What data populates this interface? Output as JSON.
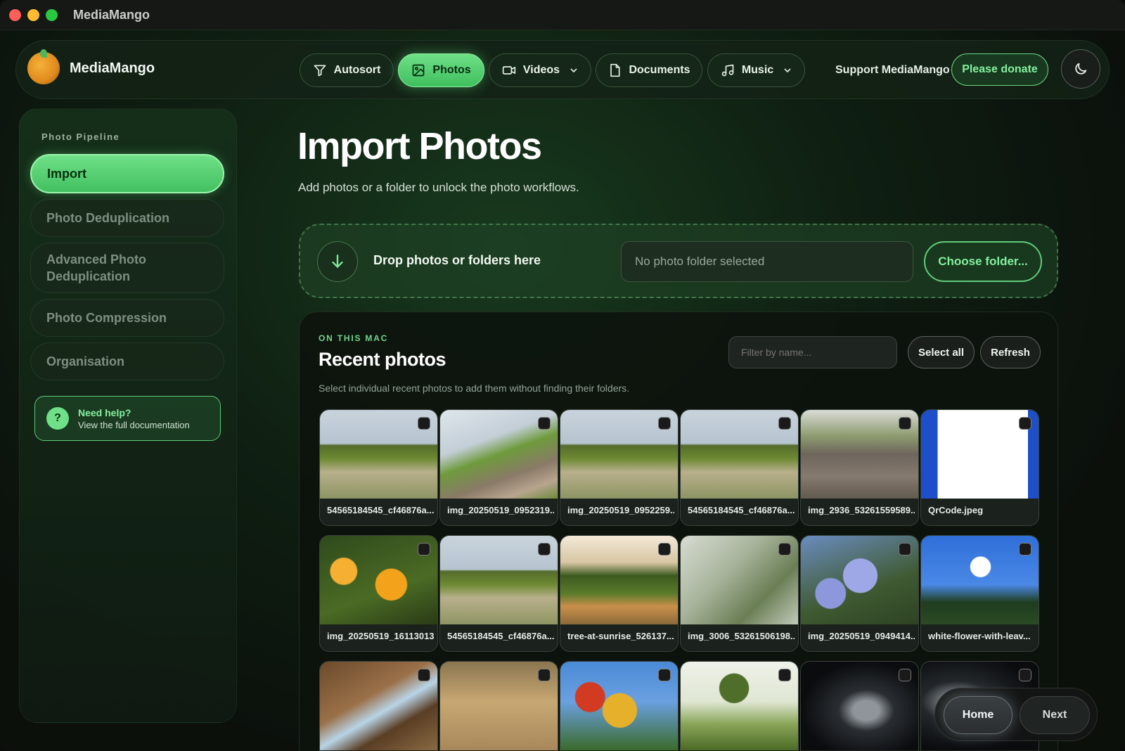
{
  "window": {
    "title": "MediaMango"
  },
  "nav": {
    "brand": "MediaMango",
    "tabs": [
      {
        "label": "Autosort",
        "icon": "filter-icon"
      },
      {
        "label": "Photos",
        "icon": "image-icon",
        "active": true
      },
      {
        "label": "Videos",
        "icon": "video-icon",
        "dropdown": true
      },
      {
        "label": "Documents",
        "icon": "document-icon"
      },
      {
        "label": "Music",
        "icon": "music-note-icon",
        "dropdown": true
      }
    ],
    "support_label": "Support MediaMango",
    "donate_label": "Please donate",
    "theme_icon": "moon-icon"
  },
  "sidebar": {
    "section_label": "Photo Pipeline",
    "items": [
      {
        "label": "Import",
        "active": true
      },
      {
        "label": "Photo Deduplication"
      },
      {
        "label": "Advanced Photo Deduplication"
      },
      {
        "label": "Photo Compression"
      },
      {
        "label": "Organisation"
      }
    ],
    "help": {
      "title": "Need help?",
      "subtitle": "View the full documentation",
      "icon_glyph": "?"
    }
  },
  "main": {
    "title": "Import Photos",
    "subtitle": "Add photos or a folder to unlock the photo workflows.",
    "dropzone": {
      "label": "Drop photos or folders here",
      "folder_value": "No photo folder selected",
      "choose_label": "Choose folder..."
    },
    "recent": {
      "kicker": "ON THIS MAC",
      "title": "Recent photos",
      "subtitle": "Select individual recent photos to add them without finding their folders.",
      "filter_placeholder": "Filter by name...",
      "select_all_label": "Select all",
      "refresh_label": "Refresh",
      "photos": [
        {
          "name": "54565184545_cf46876a...",
          "thumb": "grass"
        },
        {
          "name": "img_20250519_0952319...",
          "thumb": "hill"
        },
        {
          "name": "img_20250519_0952259...",
          "thumb": "grass"
        },
        {
          "name": "54565184545_cf46876a...",
          "thumb": "grass"
        },
        {
          "name": "img_2936_53261559589...",
          "thumb": "rock"
        },
        {
          "name": "QrCode.jpeg",
          "thumb": "qr"
        },
        {
          "name": "img_20250519_16113013...",
          "thumb": "lantana"
        },
        {
          "name": "54565184545_cf46876a...",
          "thumb": "grass"
        },
        {
          "name": "tree-at-sunrise_526137...",
          "thumb": "tree"
        },
        {
          "name": "img_3006_53261506198...",
          "thumb": "leaves"
        },
        {
          "name": "img_20250519_0949414...",
          "thumb": "plumbago"
        },
        {
          "name": "white-flower-with-leav...",
          "thumb": "whiteflower"
        },
        {
          "name": "",
          "thumb": "bark"
        },
        {
          "name": "",
          "thumb": "sand"
        },
        {
          "name": "",
          "thumb": "bananas"
        },
        {
          "name": "",
          "thumb": "palm"
        },
        {
          "name": "",
          "thumb": "dark1"
        },
        {
          "name": "",
          "thumb": "dark2"
        }
      ]
    }
  },
  "footer": {
    "home_label": "Home",
    "next_label": "Next"
  }
}
